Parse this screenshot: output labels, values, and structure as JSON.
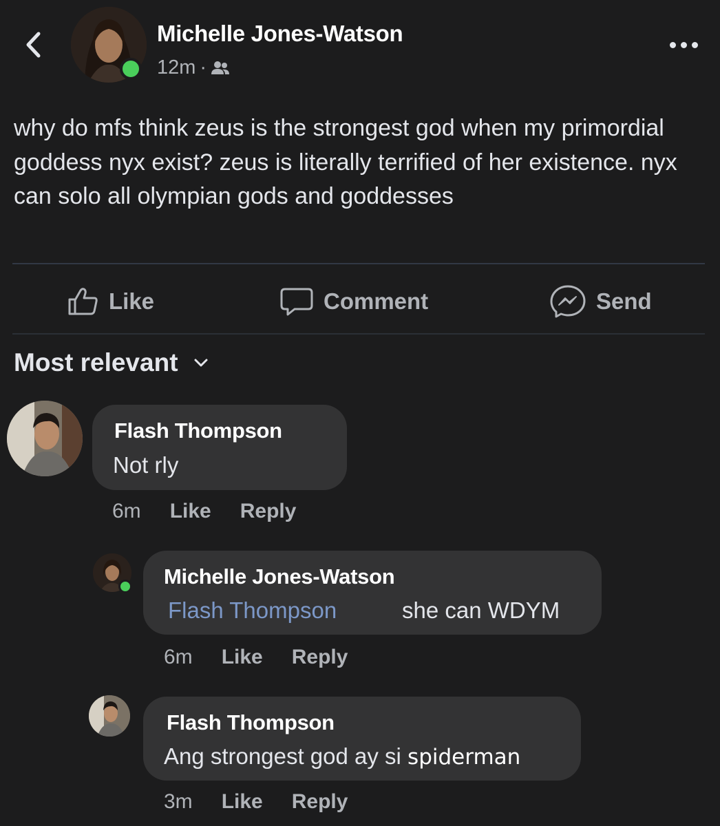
{
  "header": {
    "back_icon": "chevron-left-icon",
    "author": "Michelle Jones-Watson",
    "time": "12m",
    "separator": "·",
    "audience_icon": "friends-icon",
    "more_icon": "more-horizontal-icon"
  },
  "post": {
    "text": "why do mfs think zeus is the strongest god when my primordial goddess nyx exist? zeus is literally terrified of her existence. nyx can solo all olympian gods and goddesses"
  },
  "actions": {
    "like": "Like",
    "comment": "Comment",
    "send": "Send"
  },
  "sort": {
    "label": "Most relevant"
  },
  "comments": [
    {
      "author": "Flash Thompson",
      "text": "Not rly",
      "time": "6m",
      "like": "Like",
      "reply": "Reply"
    },
    {
      "author": "Michelle Jones-Watson",
      "mention": "Flash Thompson",
      "text": "she can WDYM",
      "time": "6m",
      "like": "Like",
      "reply": "Reply"
    },
    {
      "author": "Flash Thompson",
      "text_main": "Ang strongest god ay si",
      "text_tail": "spiderman",
      "time": "3m",
      "like": "Like",
      "reply": "Reply"
    }
  ],
  "colors": {
    "background": "#1c1c1d",
    "bubble": "#333334",
    "online": "#4ace5b",
    "mention": "#7c98c8",
    "secondary_text": "#b0b3b8"
  }
}
